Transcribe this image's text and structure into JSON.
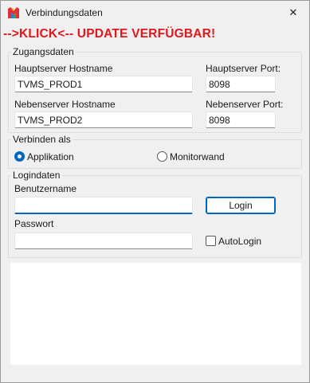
{
  "window": {
    "title": "Verbindungsdaten",
    "close_glyph": "✕",
    "icon": "app-logo-icon"
  },
  "banner": {
    "text": "-->KLICK<-- UPDATE VERFÜGBAR!",
    "color": "#e2161b"
  },
  "zugangsdaten": {
    "legend": "Zugangsdaten",
    "hauptserver_hostname_label": "Hauptserver Hostname",
    "hauptserver_hostname_value": "TVMS_PROD1",
    "hauptserver_port_label": "Hauptserver Port:",
    "hauptserver_port_value": "8098",
    "nebenserver_hostname_label": "Nebenserver Hostname",
    "nebenserver_hostname_value": "TVMS_PROD2",
    "nebenserver_port_label": "Nebenserver Port:",
    "nebenserver_port_value": "8098"
  },
  "verbinden_als": {
    "legend": "Verbinden als",
    "option_applikation": "Applikation",
    "option_monitorwand": "Monitorwand",
    "selected": "Applikation"
  },
  "logindaten": {
    "legend": "Logindaten",
    "benutzername_label": "Benutzername",
    "benutzername_value": "",
    "login_button": "Login",
    "passwort_label": "Passwort",
    "passwort_value": "",
    "autologin_label": "AutoLogin",
    "autologin_checked": false
  },
  "colors": {
    "accent": "#0067c0",
    "background": "#f0f0f0"
  }
}
